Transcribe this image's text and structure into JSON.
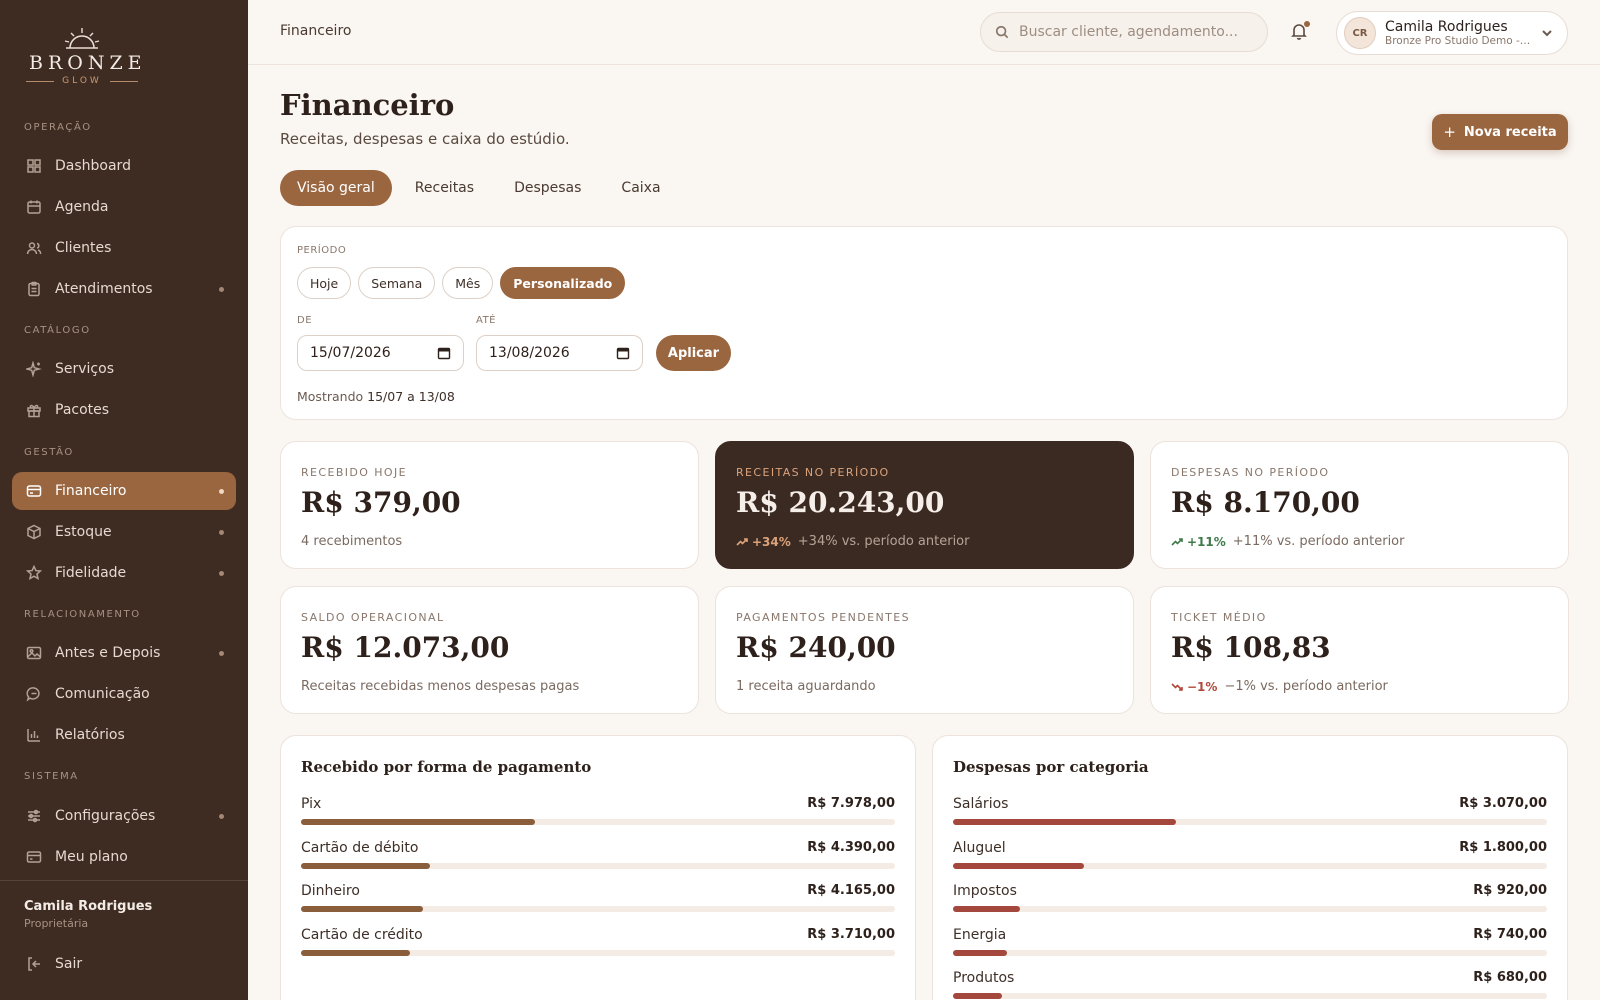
{
  "brand": {
    "name": "BRONZE",
    "tagline": "GLOW"
  },
  "sidebar": {
    "sections": [
      {
        "label": "OPERAÇÃO",
        "items": [
          {
            "label": "Dashboard",
            "icon": "dashboard-icon",
            "dot": false
          },
          {
            "label": "Agenda",
            "icon": "calendar-icon",
            "dot": false
          },
          {
            "label": "Clientes",
            "icon": "users-icon",
            "dot": false
          },
          {
            "label": "Atendimentos",
            "icon": "clipboard-icon",
            "dot": true
          }
        ]
      },
      {
        "label": "CATÁLOGO",
        "items": [
          {
            "label": "Serviços",
            "icon": "sparkles-icon",
            "dot": false
          },
          {
            "label": "Pacotes",
            "icon": "gift-icon",
            "dot": false
          }
        ]
      },
      {
        "label": "GESTÃO",
        "items": [
          {
            "label": "Financeiro",
            "icon": "wallet-icon",
            "dot": true,
            "active": true
          },
          {
            "label": "Estoque",
            "icon": "box-icon",
            "dot": true
          },
          {
            "label": "Fidelidade",
            "icon": "star-icon",
            "dot": true
          }
        ]
      },
      {
        "label": "RELACIONAMENTO",
        "items": [
          {
            "label": "Antes e Depois",
            "icon": "image-icon",
            "dot": true
          },
          {
            "label": "Comunicação",
            "icon": "chat-icon",
            "dot": false
          },
          {
            "label": "Relatórios",
            "icon": "bar-chart-icon",
            "dot": false
          }
        ]
      },
      {
        "label": "SISTEMA",
        "items": [
          {
            "label": "Configurações",
            "icon": "sliders-icon",
            "dot": true
          },
          {
            "label": "Meu plano",
            "icon": "card-icon",
            "dot": false
          }
        ]
      }
    ],
    "user": {
      "name": "Camila Rodrigues",
      "role": "Proprietária"
    },
    "logout": "Sair"
  },
  "topbar": {
    "breadcrumb": "Financeiro",
    "search_placeholder": "Buscar cliente, agendamento...",
    "user": {
      "initials": "CR",
      "name": "Camila Rodrigues",
      "studio": "Bronze Pro Studio Demo - Unidade"
    }
  },
  "page": {
    "title": "Financeiro",
    "subtitle": "Receitas, despesas e caixa do estúdio.",
    "new_button": "Nova receita",
    "tabs": [
      "Visão geral",
      "Receitas",
      "Despesas",
      "Caixa"
    ],
    "active_tab": 0
  },
  "filter": {
    "period_label": "PERÍODO",
    "periods": [
      "Hoje",
      "Semana",
      "Mês",
      "Personalizado"
    ],
    "active_period": 3,
    "from_label": "DE",
    "from_value": "15/07/2026",
    "to_label": "ATÉ",
    "to_value": "13/08/2026",
    "apply": "Aplicar",
    "showing_prefix": "Mostrando",
    "showing_range": "15/07 a 13/08"
  },
  "stats": [
    {
      "label": "RECEBIDO HOJE",
      "value": "R$ 379,00",
      "sub": "4 recebimentos"
    },
    {
      "label": "RECEITAS NO PERÍODO",
      "value": "R$ 20.243,00",
      "trend": "+34%",
      "trend_dir": "up",
      "sub": "+34% vs. período anterior",
      "dark": true
    },
    {
      "label": "DESPESAS NO PERÍODO",
      "value": "R$ 8.170,00",
      "trend": "+11%",
      "trend_dir": "up",
      "sub": "+11% vs. período anterior"
    },
    {
      "label": "SALDO OPERACIONAL",
      "value": "R$ 12.073,00",
      "sub": "Receitas recebidas menos despesas pagas"
    },
    {
      "label": "PAGAMENTOS PENDENTES",
      "value": "R$ 240,00",
      "sub": "1 receita aguardando"
    },
    {
      "label": "TICKET MÉDIO",
      "value": "R$ 108,83",
      "trend": "−1%",
      "trend_dir": "down",
      "sub": "−1% vs. período anterior"
    }
  ],
  "payments": {
    "title": "Recebido por forma de pagamento",
    "rows": [
      {
        "label": "Pix",
        "value": "R$ 7.978,00",
        "amount": 7978
      },
      {
        "label": "Cartão de débito",
        "value": "R$ 4.390,00",
        "amount": 4390
      },
      {
        "label": "Dinheiro",
        "value": "R$ 4.165,00",
        "amount": 4165
      },
      {
        "label": "Cartão de crédito",
        "value": "R$ 3.710,00",
        "amount": 3710
      }
    ],
    "total": 20243
  },
  "expenses": {
    "title": "Despesas por categoria",
    "rows": [
      {
        "label": "Salários",
        "value": "R$ 3.070,00",
        "amount": 3070
      },
      {
        "label": "Aluguel",
        "value": "R$ 1.800,00",
        "amount": 1800
      },
      {
        "label": "Impostos",
        "value": "R$ 920,00",
        "amount": 920
      },
      {
        "label": "Energia",
        "value": "R$ 740,00",
        "amount": 740
      },
      {
        "label": "Produtos",
        "value": "R$ 680,00",
        "amount": 680
      }
    ],
    "total": 8170
  },
  "colors": {
    "accent": "#9a6640",
    "sidebar": "#3e2b22",
    "payment_bar": "#8a5d3b",
    "expense_bar": "#a4473c",
    "trend_up": "#3f7a4a",
    "trend_down": "#b2473a",
    "trend_dark": "#dca37b"
  }
}
